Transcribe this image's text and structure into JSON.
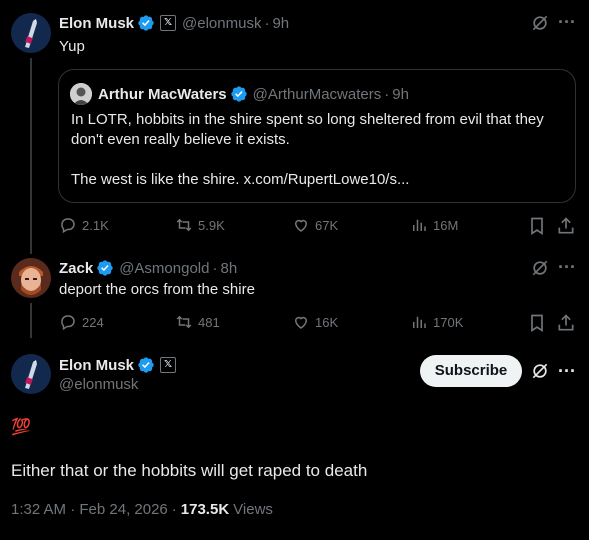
{
  "tweet1": {
    "author_name": "Elon Musk",
    "handle": "@elonmusk",
    "time": "9h",
    "text": "Yup",
    "quote": {
      "author_name": "Arthur MacWaters",
      "handle": "@ArthurMacwaters",
      "time": "9h",
      "line1": "In LOTR, hobbits in the shire spent so long sheltered from evil that they",
      "line2": "don't even really believe it exists.",
      "line3": "The west is like the shire. x.com/RupertLowe10/s..."
    },
    "stats": {
      "replies": "2.1K",
      "reposts": "5.9K",
      "likes": "67K",
      "views": "16M"
    }
  },
  "tweet2": {
    "author_name": "Zack",
    "handle": "@Asmongold",
    "time": "8h",
    "text": "deport the orcs from the shire",
    "stats": {
      "replies": "224",
      "reposts": "481",
      "likes": "16K",
      "views": "170K"
    }
  },
  "main_tweet": {
    "author_name": "Elon Musk",
    "handle": "@elonmusk",
    "subscribe_label": "Subscribe",
    "emoji": "💯",
    "text": "Either that or the hobbits will get raped to death",
    "timestamp": "1:32 AM · Feb 24, 2026",
    "views_count": "173.5K",
    "views_label": "Views"
  },
  "colors": {
    "background": "#000000",
    "text": "#e7e9ea",
    "muted": "#71767b",
    "verified": "#1d9bf0",
    "border": "#2f3336"
  }
}
